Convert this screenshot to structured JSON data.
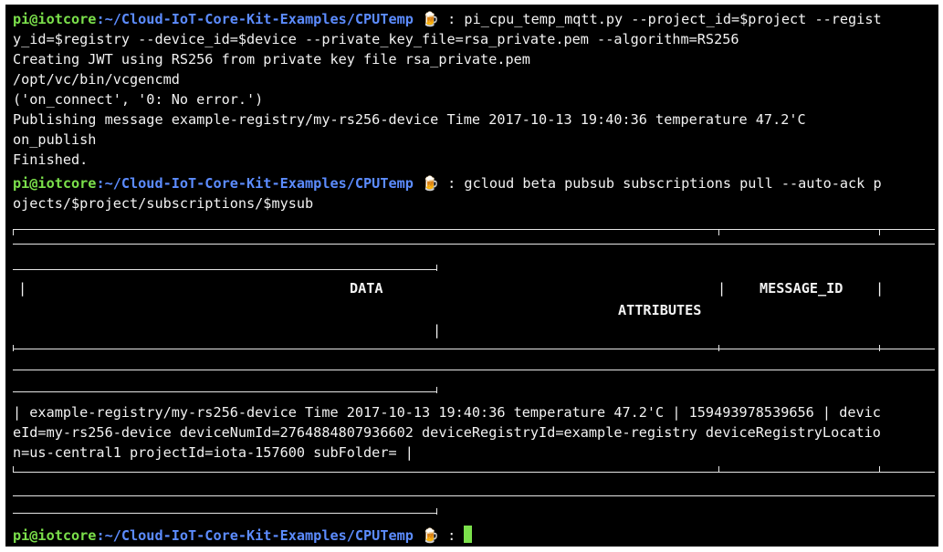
{
  "prompt": {
    "user_host": "pi@iotcore",
    "path": ":~/Cloud-IoT-Core-Kit-Examples/CPUTemp",
    "beer_icon": "🍺",
    "separator": " : "
  },
  "session": {
    "cmd1_part1": "pi_cpu_temp_mqtt.py --project_id=$project --regist",
    "cmd1_part2": "y_id=$registry --device_id=$device --private_key_file=rsa_private.pem --algorithm=RS256",
    "out1": "Creating JWT using RS256 from private key file rsa_private.pem",
    "out2": "/opt/vc/bin/vcgencmd",
    "out3": "('on_connect', '0: No error.')",
    "out4": "Publishing message example-registry/my-rs256-device Time 2017-10-13 19:40:36 temperature 47.2'C",
    "out5": "on_publish",
    "out6": "Finished.",
    "cmd2_part1": "gcloud beta pubsub subscriptions pull --auto-ack p",
    "cmd2_part2": "ojects/$project/subscriptions/$mysub"
  },
  "table": {
    "header_data": "DATA",
    "header_attributes": "ATTRIBUTES",
    "header_message_id": "MESSAGE_ID",
    "row_line1": "| example-registry/my-rs256-device Time 2017-10-13 19:40:36 temperature 47.2'C | 159493978539656 | devic",
    "row_line2": "eId=my-rs256-device deviceNumId=2764884807936602 deviceRegistryId=example-registry deviceRegistryLocatio",
    "row_line3": "n=us-central1 projectId=iota-157600 subFolder= |"
  }
}
